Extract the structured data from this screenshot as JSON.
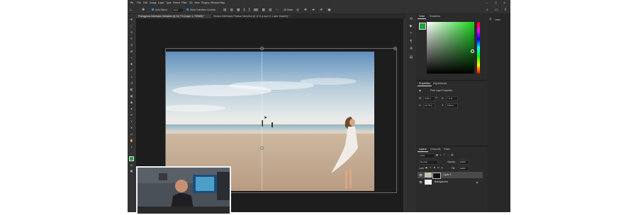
{
  "menubar": {
    "items": [
      "File",
      "Edit",
      "Image",
      "Layer",
      "Type",
      "Select",
      "Filter",
      "3D",
      "View",
      "Plugins",
      "Window",
      "Help"
    ]
  },
  "options_bar": {
    "auto_select": "Auto-Select:",
    "layer_value": "Layer",
    "show_transform": "Show Transform Controls",
    "mode_label": "3D Mode:"
  },
  "document_tabs": [
    {
      "label": "Pobsgpom Attrebado Seleções @ 16,7% (Layer 1, RGB/8) *"
    },
    {
      "label": "Modelo Attrebado Prática Seleções @ 12% (Layer 0, Layer Mask/8) *"
    }
  ],
  "panels": {
    "color_tabs": [
      "Color",
      "Swatches"
    ],
    "properties_tabs": [
      "Properties",
      "Adjustments"
    ],
    "properties_title": "Pixel Layer Properties",
    "transform": {
      "w": "4,09 in",
      "h": "7,3 in",
      "x": "12,75 in",
      "y": "5,60 in"
    },
    "layers_tabs": [
      "Layers",
      "Channels",
      "Paths"
    ],
    "layer_filter": "Kind",
    "blend_mode": "Normal",
    "opacity_label": "Opacity:",
    "opacity_value": "100%",
    "lock_label": "Lock:",
    "fill_label": "Fill:",
    "fill_value": "100%",
    "layers": [
      {
        "name": "Layer 1",
        "selected": true
      },
      {
        "name": "Background",
        "selected": false
      }
    ]
  },
  "rightmost": {
    "learn_label": "Learn"
  },
  "colors": {
    "foreground": "#1fa33a",
    "picker_hue": "#19d21d"
  }
}
